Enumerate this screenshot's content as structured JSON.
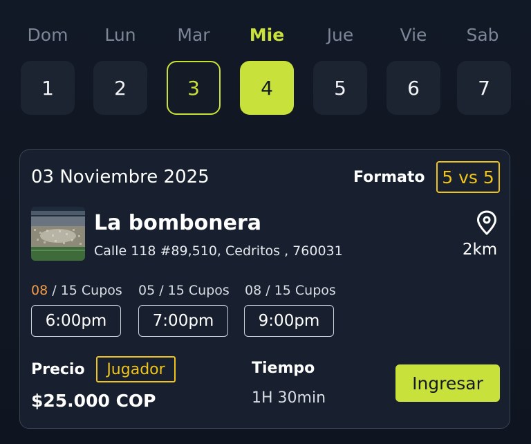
{
  "calendar": {
    "weekdays": [
      "Dom",
      "Lun",
      "Mar",
      "Mie",
      "Jue",
      "Vie",
      "Sab"
    ],
    "days": [
      "1",
      "2",
      "3",
      "4",
      "5",
      "6",
      "7"
    ],
    "active_index": 3,
    "outlined_index": 2
  },
  "colors": {
    "accent": "#c8e13b",
    "badge": "#f0c419",
    "highlight_count": "#f39c4a",
    "card_bg": "#182030",
    "page_bg": "#121926"
  },
  "match": {
    "date": "03 Noviembre 2025",
    "format_label": "Formato",
    "format_value": "5 vs 5",
    "venue_name": "La bombonera",
    "venue_address": "Calle 118 #89,510, Cedritos , 760031",
    "distance": "2km",
    "location_icon": "map-pin-icon",
    "venue_image": "stadium-photo"
  },
  "slots": [
    {
      "taken": "08",
      "total": "/ 15 Cupos",
      "time": "6:00pm",
      "highlight": true
    },
    {
      "taken": "05",
      "total": "/ 15 Cupos",
      "time": "7:00pm",
      "highlight": false
    },
    {
      "taken": "08",
      "total": "/ 15 Cupos",
      "time": "9:00pm",
      "highlight": false
    }
  ],
  "pricing": {
    "price_label": "Precio",
    "player_badge": "Jugador",
    "price_value": "$25.000 COP",
    "time_label": "Tiempo",
    "time_value": "1H 30min",
    "enter_button": "Ingresar"
  }
}
